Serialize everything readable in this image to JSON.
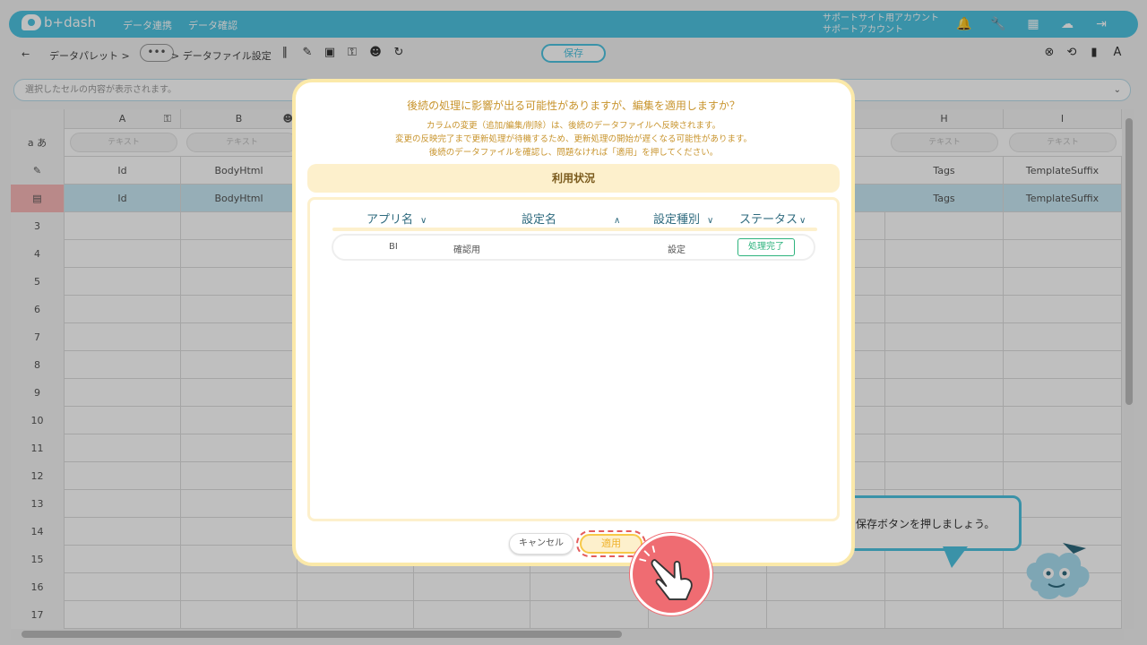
{
  "app": {
    "logo_text": "b+dash",
    "nav": [
      "データ連携",
      "データ確認"
    ],
    "account_line1": "サポートサイト用アカウント",
    "account_line2": "サポートアカウント"
  },
  "toolbar": {
    "back": "←",
    "crumb1": "データパレット >",
    "more": "•••",
    "crumb2": "> データファイル設定",
    "save_label": "保存"
  },
  "cellbar": {
    "placeholder": "選択したセルの内容が表示されます。"
  },
  "sheet": {
    "columns": [
      "A",
      "B",
      "H",
      "I"
    ],
    "type_row_label": "a あ",
    "type_placeholder": "テキスト",
    "field_row": [
      "Id",
      "BodyHtml",
      "Tags",
      "TemplateSuffix"
    ],
    "data_row": [
      "Id",
      "BodyHtml",
      "Tags",
      "TemplateSuffix"
    ],
    "row_numbers": [
      "3",
      "4",
      "5",
      "6",
      "7",
      "8",
      "9",
      "10",
      "11",
      "12",
      "13",
      "14",
      "15",
      "16",
      "17"
    ]
  },
  "help": {
    "text": "保存ボタンを押しましょう。"
  },
  "modal": {
    "title": "後続の処理に影響が出る可能性がありますが、編集を適用しますか？",
    "line1": "カラムの変更（追加/編集/削除）は、後続のデータファイルへ反映されます。",
    "line2": "変更の反映完了まで更新処理が待機するため、更新処理の開始が遅くなる可能性があります。",
    "line3": "後続のデータファイルを確認し、問題なければ「適用」を押してください。",
    "usage_title": "利用状況",
    "columns": [
      "アプリ名",
      "設定名",
      "設定種別",
      "ステータス"
    ],
    "rows": [
      {
        "app": "BI",
        "name": "確認用",
        "kind": "設定",
        "status": "処理完了"
      }
    ],
    "cancel_label": "キャンセル",
    "apply_label": "適用"
  },
  "colors": {
    "brand": "#4ec3e0",
    "modal_border": "#fbe9a9",
    "status_ok": "#2db37d",
    "pointer": "#ef6c72"
  }
}
